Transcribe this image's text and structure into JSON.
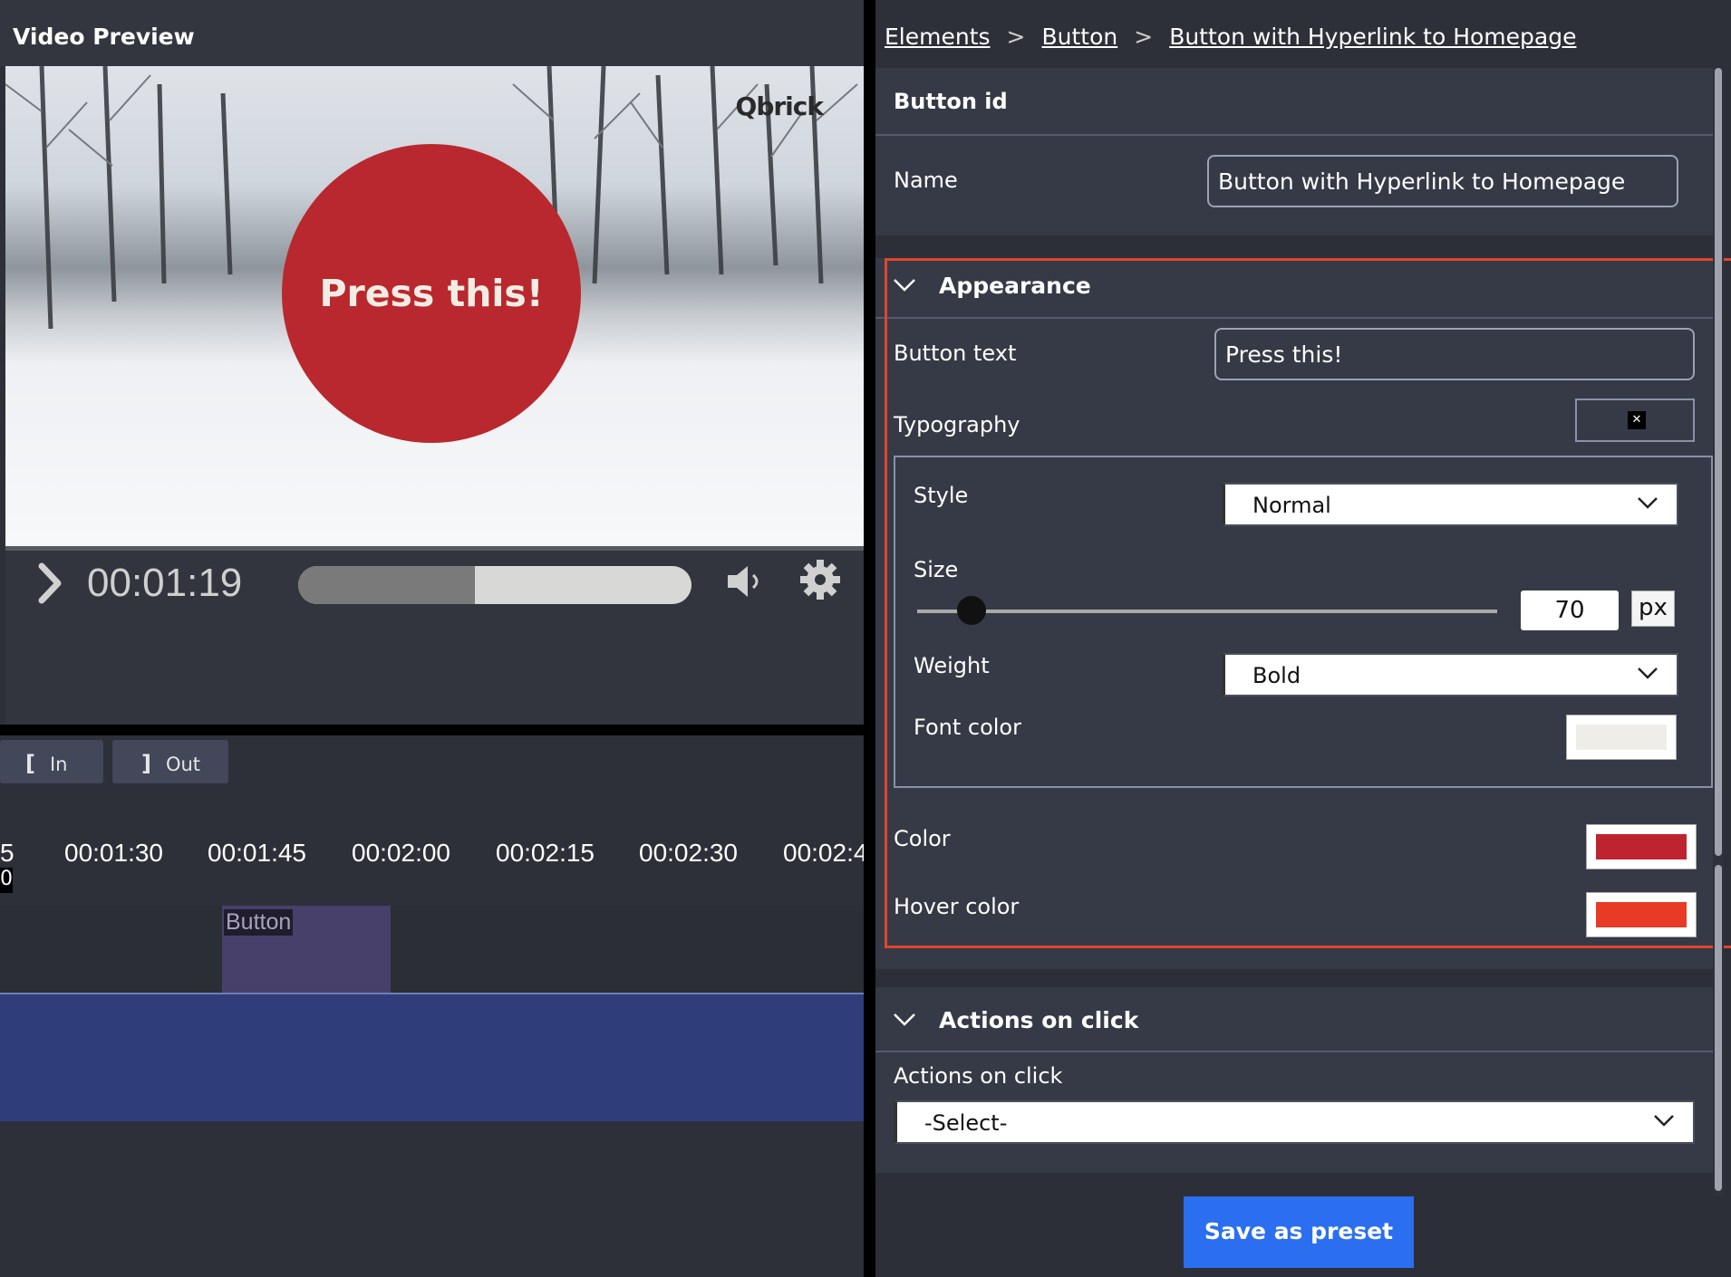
{
  "left_panel": {
    "title": "Video Preview",
    "video": {
      "logo": "Qbrick",
      "overlay_button_text": "Press this!",
      "overlay_button_color": "#b9282e"
    },
    "controls": {
      "play_icon": "play-icon",
      "time": "00:01:19",
      "progress": 0.45,
      "volume_icon": "volume-icon",
      "settings_icon": "gear-icon"
    },
    "in_label": "In",
    "out_label": "Out",
    "ruler": [
      "5",
      "00:01:30",
      "00:01:45",
      "00:02:00",
      "00:02:15",
      "00:02:30",
      "00:02:4"
    ],
    "ruler_marker": "0",
    "clip_label": "Button"
  },
  "right_panel": {
    "breadcrumb": [
      "Elements",
      "Button",
      "Button with Hyperlink to Homepage"
    ],
    "button_id_label": "Button id",
    "name_label": "Name",
    "name_value": "Button with Hyperlink to Homepage",
    "appearance": {
      "header": "Appearance",
      "button_text_label": "Button text",
      "button_text_value": "Press this!",
      "typography_label": "Typography",
      "style_label": "Style",
      "style_value": "Normal",
      "size_label": "Size",
      "size_value": "70",
      "size_unit": "px",
      "weight_label": "Weight",
      "weight_value": "Bold",
      "font_color_label": "Font color",
      "font_color": "#efede8",
      "color_label": "Color",
      "color": "#be2430",
      "hover_color_label": "Hover color",
      "hover_color": "#e83b25"
    },
    "actions": {
      "header": "Actions on click",
      "label": "Actions on click",
      "select_value": "-Select-"
    },
    "save_label": "Save as preset"
  }
}
